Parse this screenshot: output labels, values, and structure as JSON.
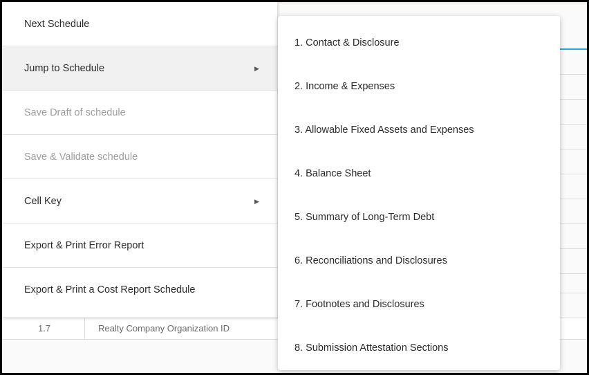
{
  "menu": {
    "items": [
      {
        "label": "Next Schedule",
        "disabled": false,
        "has_submenu": false
      },
      {
        "label": "Jump to Schedule",
        "disabled": false,
        "has_submenu": true
      },
      {
        "label": "Save Draft of schedule",
        "disabled": true,
        "has_submenu": false
      },
      {
        "label": "Save & Validate schedule",
        "disabled": true,
        "has_submenu": false
      },
      {
        "label": "Cell Key",
        "disabled": false,
        "has_submenu": true
      },
      {
        "label": "Export & Print Error Report",
        "disabled": false,
        "has_submenu": false
      },
      {
        "label": "Export & Print a Cost Report Schedule",
        "disabled": false,
        "has_submenu": false
      }
    ],
    "submenu_arrow": "▶"
  },
  "submenu": {
    "items": [
      "1. Contact & Disclosure",
      "2. Income & Expenses",
      "3. Allowable Fixed Assets and Expenses",
      "4. Balance Sheet",
      "5. Summary of Long-Term Debt",
      "6. Reconciliations and Disclosures",
      "7. Footnotes and Disclosures",
      "8. Submission Attestation Sections"
    ]
  },
  "background_table": {
    "row": {
      "number": "1.7",
      "text": "Realty Company Organization ID"
    }
  },
  "colors": {
    "accent": "#29a9d8",
    "disabled_text": "#9d9d9d",
    "text": "#2b2b2b"
  }
}
